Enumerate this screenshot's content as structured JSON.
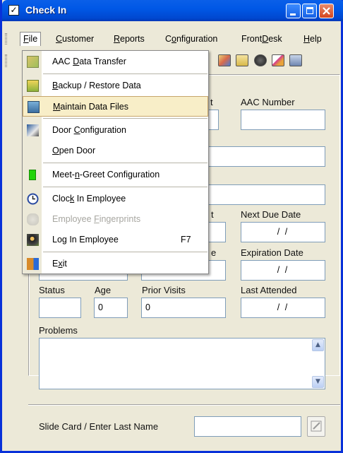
{
  "window": {
    "title": "Check In",
    "title_icon": "checkbox-icon"
  },
  "menubar": {
    "items": [
      {
        "label_pre": "",
        "label_u": "F",
        "label_post": "ile"
      },
      {
        "label_pre": "",
        "label_u": "C",
        "label_post": "ustomer"
      },
      {
        "label_pre": "",
        "label_u": "R",
        "label_post": "eports"
      },
      {
        "label_pre": "C",
        "label_u": "o",
        "label_post": "nfiguration"
      },
      {
        "label_pre": "Front",
        "label_u": "D",
        "label_post": "esk"
      },
      {
        "label_pre": "",
        "label_u": "H",
        "label_post": "elp"
      }
    ]
  },
  "file_menu": {
    "items": [
      {
        "label_pre": "AAC ",
        "label_u": "D",
        "label_post": "ata Transfer",
        "icon": "data-transfer-icon"
      },
      {
        "label_pre": "",
        "label_u": "B",
        "label_post": "ackup / Restore Data",
        "icon": "backup-icon"
      },
      {
        "label_pre": "",
        "label_u": "M",
        "label_post": "aintain Data Files",
        "icon": "maintain-files-icon"
      },
      {
        "label_pre": "Door ",
        "label_u": "C",
        "label_post": "onfiguration",
        "icon": "door-config-icon"
      },
      {
        "label_pre": "",
        "label_u": "O",
        "label_post": "pen Door",
        "icon": ""
      },
      {
        "label_pre": "Meet-",
        "label_u": "n",
        "label_post": "-Greet Configuration",
        "icon": "green-status-icon"
      },
      {
        "label_pre": "Cloc",
        "label_u": "k",
        "label_post": " In Employee",
        "icon": "clock-icon"
      },
      {
        "label_pre": "Employee ",
        "label_u": "F",
        "label_post": "ingerprints",
        "icon": "fingerprint-hand-icon"
      },
      {
        "label_pre": "Lo",
        "label_u": "g",
        "label_post": " In Employee",
        "icon": "employee-login-icon",
        "shortcut": "F7"
      },
      {
        "label_pre": "E",
        "label_u": "x",
        "label_post": "it",
        "icon": "exit-door-icon"
      }
    ]
  },
  "form": {
    "aac_number_label": "AAC Number",
    "aac_number_value": "",
    "next_due_date_label": "Next Due Date",
    "next_due_date_value": "/   /",
    "expiration_date_label": "Expiration Date",
    "expiration_date_value": "/   /",
    "status_label": "Status",
    "status_value": "",
    "age_label": "Age",
    "age_value": "0",
    "prior_visits_label": "Prior Visits",
    "prior_visits_value": "0",
    "last_attended_label": "Last Attended",
    "last_attended_value": "/   /",
    "problems_label": "Problems",
    "problems_value": "",
    "partial_label_1": "t",
    "partial_label_2": "e",
    "slide_card_label": "Slide Card / Enter Last Name",
    "slide_card_value": ""
  }
}
